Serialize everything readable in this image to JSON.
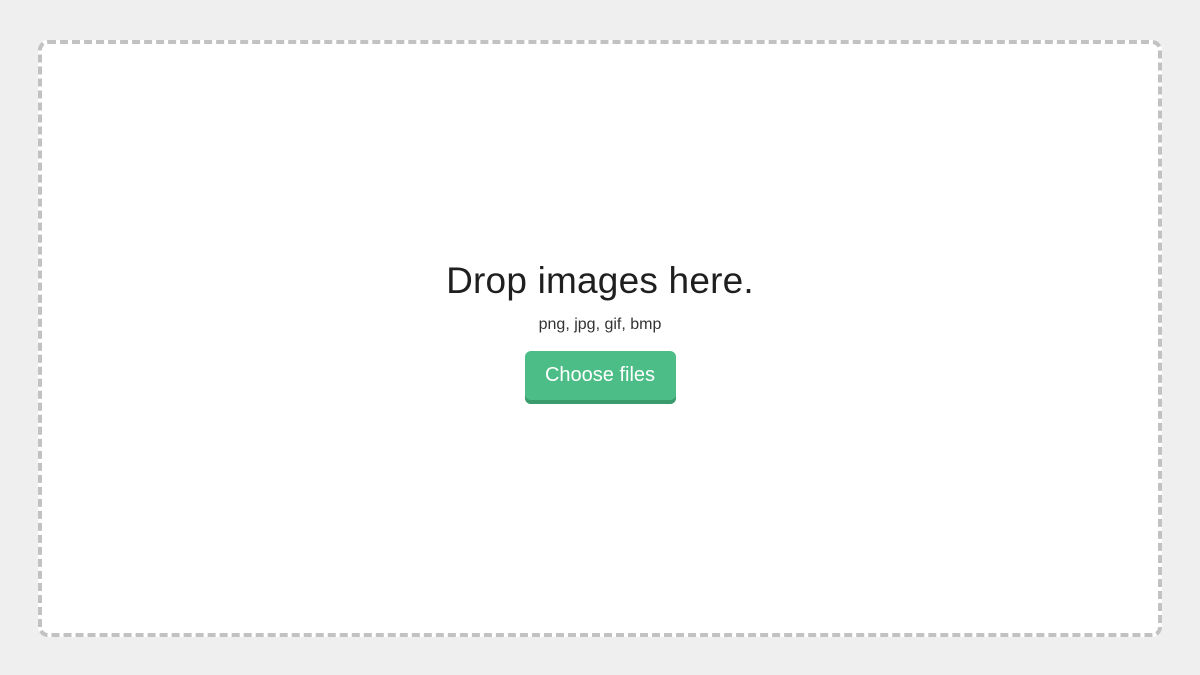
{
  "dropzone": {
    "title": "Drop images here.",
    "formats": "png, jpg, gif, bmp",
    "button_label": "Choose files"
  },
  "colors": {
    "background": "#efefef",
    "panel": "#ffffff",
    "border": "#c2c2c2",
    "button": "#4cbd86",
    "button_shadow": "#3a9c6c"
  }
}
